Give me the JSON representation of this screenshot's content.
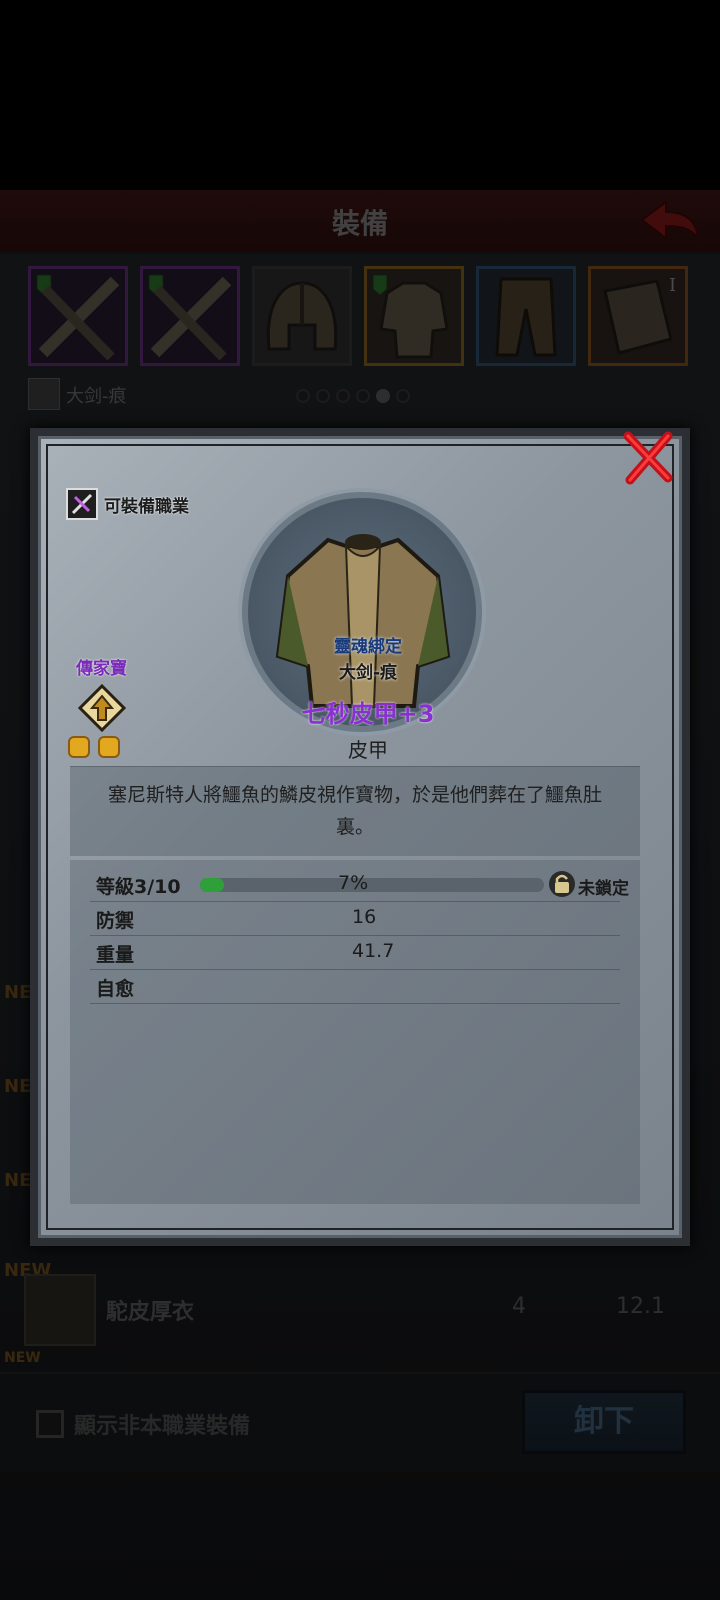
{
  "header": {
    "title": "裝備"
  },
  "slot_badge": "I",
  "equipped_weapon": {
    "name": "大剑-痕"
  },
  "pager": {
    "total": 6,
    "active": 4
  },
  "list": [
    {
      "new": "NEW"
    },
    {
      "new": "NEW"
    },
    {
      "new": "NEW"
    },
    {
      "new": "NEW",
      "name": "駝皮厚衣",
      "defense": "4",
      "weight": "12.1"
    },
    {
      "new": "NEW"
    }
  ],
  "bottom": {
    "checkbox_label": "顯示非本職業裝備",
    "unequip_label": "卸下"
  },
  "modal": {
    "class_label": "可裝備職業",
    "heirloom_label": "傳家寶",
    "heirloom_count": 2,
    "soulbound": "靈魂綁定",
    "bound_name": "大剑-痕",
    "item_name": "七秒皮甲+3",
    "item_type": "皮甲",
    "description": "塞尼斯特人將鱷魚的鱗皮視作寶物，於是他們葬在了鱷魚肚裏。",
    "level_label": "等級3/10",
    "level_progress_percent": 7,
    "level_pct_text": "7%",
    "lock_label": "未鎖定",
    "stats": [
      {
        "label": "防禦",
        "value": "16"
      },
      {
        "label": "重量",
        "value": "41.7"
      },
      {
        "label": "自愈",
        "value": ""
      }
    ]
  },
  "colors": {
    "item_name": "#8a2fd0",
    "heirloom": "#7a2cb8",
    "soulbound": "#1a3a7a",
    "progress": "#2ea03a"
  }
}
